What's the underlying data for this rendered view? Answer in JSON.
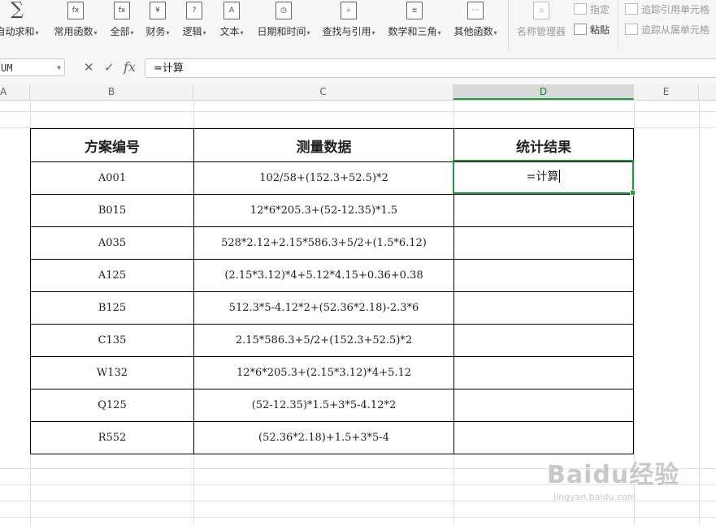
{
  "ribbon": {
    "buttons": [
      {
        "label": "自动求和",
        "icon": "sigma-icon",
        "glyph": "∑"
      },
      {
        "label": "常用函数",
        "icon": "fx-star-icon",
        "glyph": "fx"
      },
      {
        "label": "全部",
        "icon": "fx-icon",
        "glyph": "fx"
      },
      {
        "label": "财务",
        "icon": "yen-book-icon",
        "glyph": "¥"
      },
      {
        "label": "逻辑",
        "icon": "question-book-icon",
        "glyph": "?"
      },
      {
        "label": "文本",
        "icon": "text-book-icon",
        "glyph": "A"
      },
      {
        "label": "日期和时间",
        "icon": "clock-book-icon",
        "glyph": "◷"
      },
      {
        "label": "查找与引用",
        "icon": "search-book-icon",
        "glyph": "⌕"
      },
      {
        "label": "数学和三角",
        "icon": "math-book-icon",
        "glyph": "±"
      },
      {
        "label": "其他函数",
        "icon": "more-book-icon",
        "glyph": "⋯"
      }
    ],
    "name_manager": "名称管理器",
    "specify": "指定",
    "paste": "粘贴",
    "trace_precedents": "追踪引用单元格",
    "trace_dependents": "追踪从属单元格"
  },
  "formula_bar": {
    "name_box": "UM",
    "cancel_glyph": "✕",
    "confirm_glyph": "✓",
    "fx_label": "fx",
    "formula": "=计算"
  },
  "columns": [
    "A",
    "B",
    "C",
    "D",
    "E"
  ],
  "table": {
    "headers": [
      "方案编号",
      "测量数据",
      "统计结果"
    ],
    "rows": [
      {
        "id": "A001",
        "data": "102/58+(152.3+52.5)*2"
      },
      {
        "id": "B015",
        "data": "12*6*205.3+(52-12.35)*1.5"
      },
      {
        "id": "A035",
        "data": "528*2.12+2.15*586.3+5/2+(1.5*6.12)"
      },
      {
        "id": "A125",
        "data": "(2.15*3.12)*4+5.12*4.15+0.36+0.38"
      },
      {
        "id": "B125",
        "data": "512.3*5-4.12*2+(52.36*2.18)-2.3*6"
      },
      {
        "id": "C135",
        "data": "2.15*586.3+5/2+(152.3+52.5)*2"
      },
      {
        "id": "W132",
        "data": "12*6*205.3+(2.15*3.12)*4+5.12"
      },
      {
        "id": "Q125",
        "data": "(52-12.35)*1.5+3*5-4.12*2"
      },
      {
        "id": "R552",
        "data": "(52.36*2.18)+1.5+3*5-4"
      }
    ]
  },
  "active_cell_text": "=计算",
  "watermark": {
    "logo": "Baidu经验",
    "url": "jingyan.baidu.com"
  }
}
